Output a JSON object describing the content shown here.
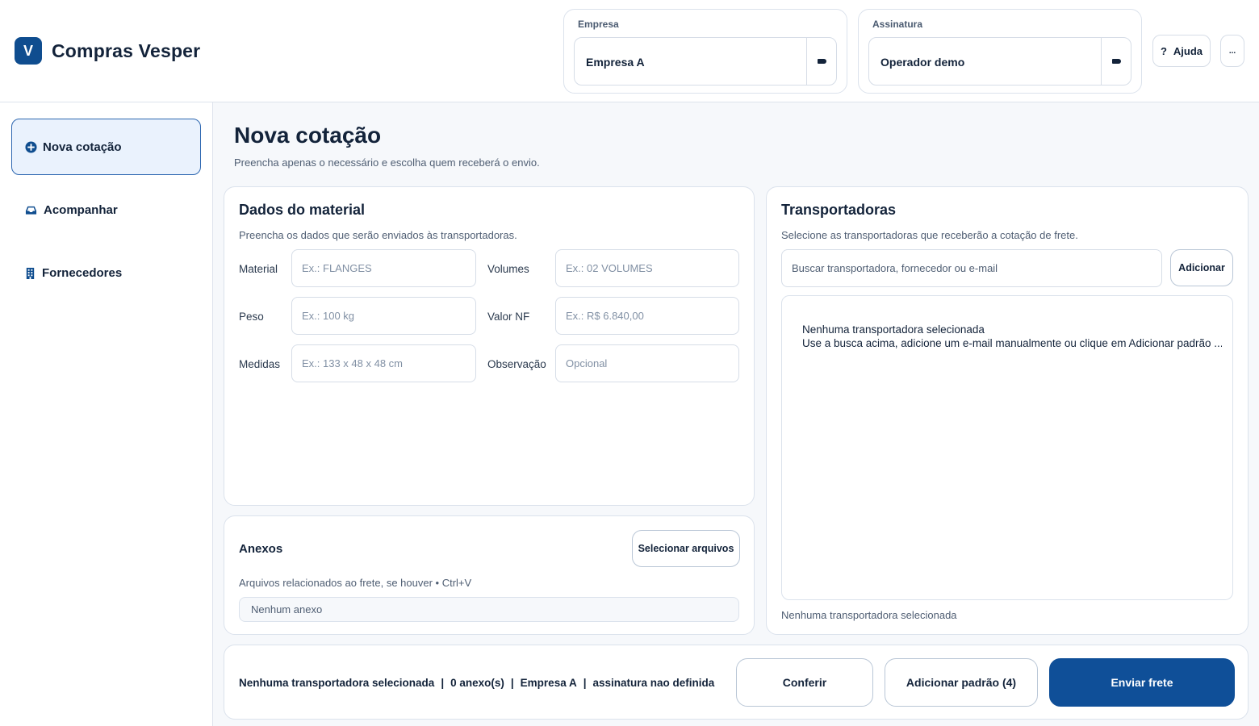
{
  "app": {
    "logo_letter": "V",
    "title": "Compras Vesper"
  },
  "header": {
    "company": {
      "label": "Empresa",
      "value": "Empresa A"
    },
    "signature": {
      "label": "Assinatura",
      "value": "Operador demo"
    },
    "help_icon": "?",
    "help_label": "Ajuda",
    "more_label": "..."
  },
  "sidebar": {
    "items": [
      {
        "label": "Nova cotação",
        "icon": "plus-circle-icon",
        "active": true
      },
      {
        "label": "Acompanhar",
        "icon": "inbox-icon",
        "active": false
      },
      {
        "label": "Fornecedores",
        "icon": "building-icon",
        "active": false
      }
    ]
  },
  "page": {
    "title": "Nova cotação",
    "subtitle": "Preencha apenas o necessário e escolha quem receberá o envio."
  },
  "material": {
    "title": "Dados do material",
    "subtitle": "Preencha os dados que serão enviados às transportadoras.",
    "fields": {
      "material": {
        "label": "Material",
        "placeholder": "Ex.: FLANGES"
      },
      "volumes": {
        "label": "Volumes",
        "placeholder": "Ex.: 02 VOLUMES"
      },
      "peso": {
        "label": "Peso",
        "placeholder": "Ex.: 100 kg"
      },
      "valor_nf": {
        "label": "Valor NF",
        "placeholder": "Ex.: R$ 6.840,00"
      },
      "medidas": {
        "label": "Medidas",
        "placeholder": "Ex.: 133 x 48 x 48 cm"
      },
      "observacao": {
        "label": "Observação",
        "placeholder": "Opcional"
      }
    }
  },
  "attachments": {
    "title": "Anexos",
    "select_button": "Selecionar arquivos",
    "hint": "Arquivos relacionados ao frete, se houver • Ctrl+V",
    "empty": "Nenhum anexo"
  },
  "carriers": {
    "title": "Transportadoras",
    "subtitle": "Selecione as transportadoras que receberão a cotação de frete.",
    "search_placeholder": "Buscar transportadora, fornecedor ou e-mail",
    "add_button": "Adicionar",
    "empty_title": "Nenhuma transportadora selecionada",
    "empty_hint": "Use a busca acima, adicione um e-mail manualmente ou clique em Adicionar padrão ...",
    "footer_status": "Nenhuma transportadora selecionada"
  },
  "footer": {
    "summary": {
      "carriers": "Nenhuma transportadora selecionada",
      "attachments": "0 anexo(s)",
      "company": "Empresa A",
      "signature": "assinatura nao definida",
      "separator": "|"
    },
    "check_button": "Conferir",
    "add_default_button": "Adicionar padrão (4)",
    "send_button": "Enviar frete"
  },
  "colors": {
    "primary": "#0f4f98",
    "active_nav_bg": "#eaf2fd",
    "active_nav_border": "#2c66b0",
    "text": "#13233a"
  }
}
